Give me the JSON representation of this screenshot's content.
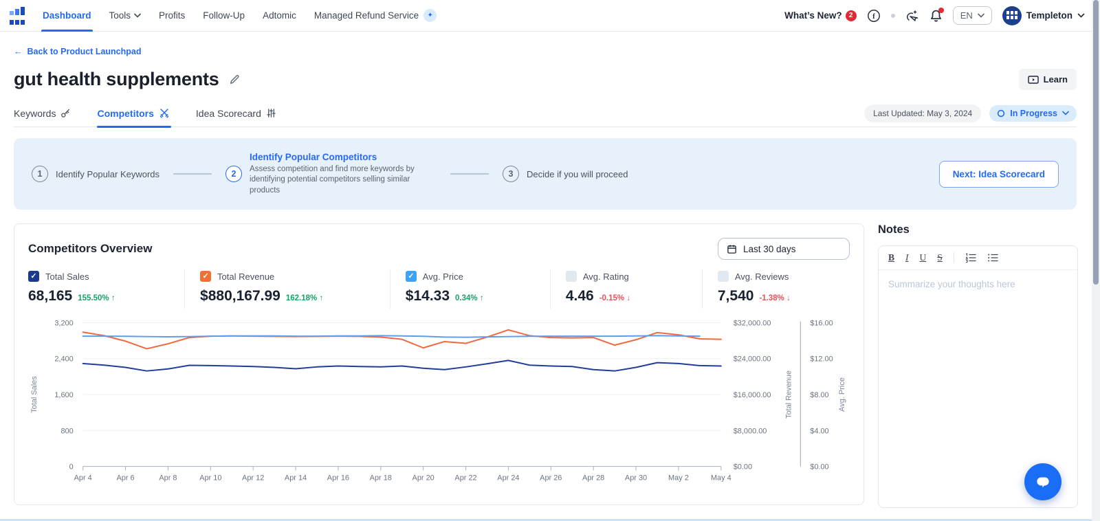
{
  "nav": {
    "items": [
      "Dashboard",
      "Tools",
      "Profits",
      "Follow-Up",
      "Adtomic",
      "Managed Refund Service"
    ],
    "whats_new": "What’s New?",
    "whats_new_count": "2",
    "language": "EN",
    "user_name": "Templeton"
  },
  "page": {
    "back_link": "Back to Product Launchpad",
    "title": "gut health supplements",
    "learn_button": "Learn",
    "tabs": [
      {
        "label": "Keywords"
      },
      {
        "label": "Competitors"
      },
      {
        "label": "Idea Scorecard"
      }
    ],
    "last_updated": "Last Updated: May 3, 2024",
    "status_label": "In Progress"
  },
  "stepper": {
    "steps": [
      {
        "number": "1",
        "title": "Identify Popular Keywords"
      },
      {
        "number": "2",
        "title": "Identify Popular Competitors",
        "description": "Assess competition and find more keywords by identifying potential competitors selling similar products"
      },
      {
        "number": "3",
        "title": "Decide if you will proceed"
      }
    ],
    "next_button": "Next: Idea Scorecard"
  },
  "overview": {
    "title": "Competitors Overview",
    "date_range": "Last 30 days",
    "metrics": [
      {
        "label": "Total Sales",
        "value": "68,165",
        "delta": "155.50%",
        "direction": "up",
        "state": "checked",
        "checkbox_color": "#1b3a8c"
      },
      {
        "label": "Total Revenue",
        "value": "$880,167.99",
        "delta": "162.18%",
        "direction": "up",
        "state": "checked",
        "checkbox_color": "#f07036"
      },
      {
        "label": "Avg. Price",
        "value": "$14.33",
        "delta": "0.34%",
        "direction": "up",
        "state": "checked",
        "checkbox_color": "#3ba3f8"
      },
      {
        "label": "Avg. Rating",
        "value": "4.46",
        "delta": "-0.15%",
        "direction": "down",
        "state": "unchecked"
      },
      {
        "label": "Avg. Reviews",
        "value": "7,540",
        "delta": "-1.38%",
        "direction": "down",
        "state": "unchecked"
      }
    ]
  },
  "chart_data": {
    "type": "line",
    "x": [
      "Apr 4",
      "Apr 5",
      "Apr 6",
      "Apr 7",
      "Apr 8",
      "Apr 9",
      "Apr 10",
      "Apr 11",
      "Apr 12",
      "Apr 13",
      "Apr 14",
      "Apr 15",
      "Apr 16",
      "Apr 17",
      "Apr 18",
      "Apr 19",
      "Apr 20",
      "Apr 21",
      "Apr 22",
      "Apr 23",
      "Apr 24",
      "Apr 25",
      "Apr 26",
      "Apr 27",
      "Apr 28",
      "Apr 29",
      "Apr 30",
      "May 1",
      "May 2",
      "May 3",
      "May 4"
    ],
    "x_tick_labels": [
      "Apr 4",
      "Apr 6",
      "Apr 8",
      "Apr 10",
      "Apr 12",
      "Apr 14",
      "Apr 16",
      "Apr 18",
      "Apr 20",
      "Apr 22",
      "Apr 24",
      "Apr 26",
      "Apr 28",
      "Apr 30",
      "May 2",
      "May 4"
    ],
    "left_axis": {
      "label": "Total Sales",
      "ticks": [
        "0",
        "800",
        "1,600",
        "2,400",
        "3,200"
      ],
      "range": [
        0,
        3200
      ]
    },
    "right_axis_1": {
      "label": "Total Revenue",
      "ticks": [
        "$0.00",
        "$8,000.00",
        "$16,000.00",
        "$24,000.00",
        "$32,000.00"
      ],
      "range": [
        0,
        32000
      ]
    },
    "right_axis_2": {
      "label": "Avg. Price",
      "ticks": [
        "$0.00",
        "$4.00",
        "$8.00",
        "$12.00",
        "$16.00"
      ],
      "range": [
        0,
        16
      ]
    },
    "series": [
      {
        "name": "Total Sales",
        "color": "#1f3d99",
        "axis": "left",
        "max": 3200,
        "values": [
          2290,
          2255,
          2205,
          2125,
          2170,
          2250,
          2245,
          2235,
          2225,
          2205,
          2175,
          2215,
          2235,
          2225,
          2215,
          2235,
          2185,
          2155,
          2215,
          2285,
          2360,
          2255,
          2235,
          2225,
          2155,
          2125,
          2205,
          2310,
          2290,
          2245,
          2235
        ]
      },
      {
        "name": "Total Revenue",
        "color": "#f0683c",
        "axis": "right1",
        "max": 32000,
        "values": [
          29900,
          29100,
          27900,
          26200,
          27300,
          28700,
          29000,
          29050,
          29000,
          28950,
          28900,
          28950,
          29000,
          28950,
          28800,
          28300,
          26400,
          27800,
          27400,
          28800,
          30400,
          29100,
          28700,
          28600,
          28700,
          27000,
          28200,
          29800,
          29300,
          28400,
          28300
        ]
      },
      {
        "name": "Avg. Price",
        "color": "#5d9cec",
        "axis": "right2",
        "max": 16,
        "values": [
          14.5,
          14.5,
          14.48,
          14.45,
          14.43,
          14.45,
          14.5,
          14.52,
          14.53,
          14.52,
          14.5,
          14.5,
          14.52,
          14.53,
          14.55,
          14.53,
          14.48,
          14.4,
          14.38,
          14.42,
          14.45,
          14.48,
          14.5,
          14.5,
          14.5,
          14.5,
          14.52,
          14.55,
          14.52,
          14.5,
          null
        ]
      }
    ],
    "grid": true,
    "legend_position": "none"
  },
  "notes": {
    "title": "Notes",
    "placeholder": "Summarize your thoughts here",
    "toolbar": {
      "bold": "B",
      "italic": "I",
      "underline": "U",
      "strike": "S"
    }
  }
}
